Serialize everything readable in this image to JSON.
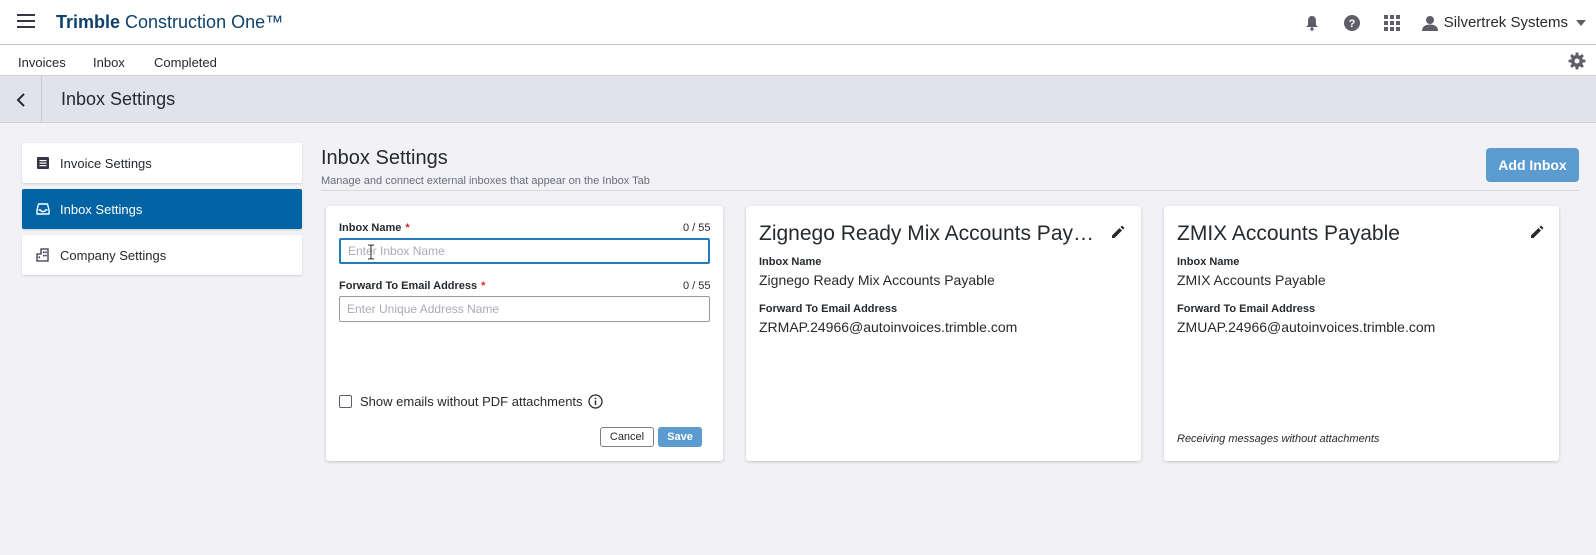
{
  "app": {
    "brand_bold": "Trimble",
    "brand_rest": " Construction One™",
    "user_name": "Silvertrek Systems"
  },
  "tabs": [
    "Invoices",
    "Inbox",
    "Completed"
  ],
  "page_header": {
    "title": "Inbox Settings"
  },
  "sidebar": {
    "items": [
      {
        "label": "Invoice Settings",
        "icon": "list-icon"
      },
      {
        "label": "Inbox Settings",
        "icon": "inbox-icon",
        "active": true
      },
      {
        "label": "Company Settings",
        "icon": "building-icon"
      }
    ]
  },
  "content": {
    "title": "Inbox Settings",
    "subtitle": "Manage and connect external inboxes that appear on the Inbox Tab",
    "add_button": "Add Inbox"
  },
  "form": {
    "inbox_name_label": "Inbox Name",
    "inbox_name_counter": "0 / 55",
    "inbox_name_placeholder": "Enter Inbox Name",
    "inbox_name_value": "",
    "email_label": "Forward To Email Address",
    "email_counter": "0 / 55",
    "email_placeholder": "Enter Unique Address Name",
    "email_value": "",
    "required_mark": "*",
    "checkbox_label": "Show emails without PDF attachments",
    "checkbox_checked": false,
    "cancel": "Cancel",
    "save": "Save"
  },
  "inboxes": [
    {
      "title": "Zignego Ready Mix Accounts Payable",
      "name_label": "Inbox Name",
      "name": "Zignego Ready Mix Accounts Payable",
      "email_label": "Forward To Email Address",
      "email": "ZRMAP.24966@autoinvoices.trimble.com",
      "note": ""
    },
    {
      "title": "ZMIX Accounts Payable",
      "name_label": "Inbox Name",
      "name": "ZMIX Accounts Payable",
      "email_label": "Forward To Email Address",
      "email": "ZMUAP.24966@autoinvoices.trimble.com",
      "note": "Receiving messages without attachments"
    }
  ],
  "colors": {
    "brand": "#0e416c",
    "primary": "#0063a3",
    "button": "#5b9bd0",
    "required": "#da212c"
  }
}
